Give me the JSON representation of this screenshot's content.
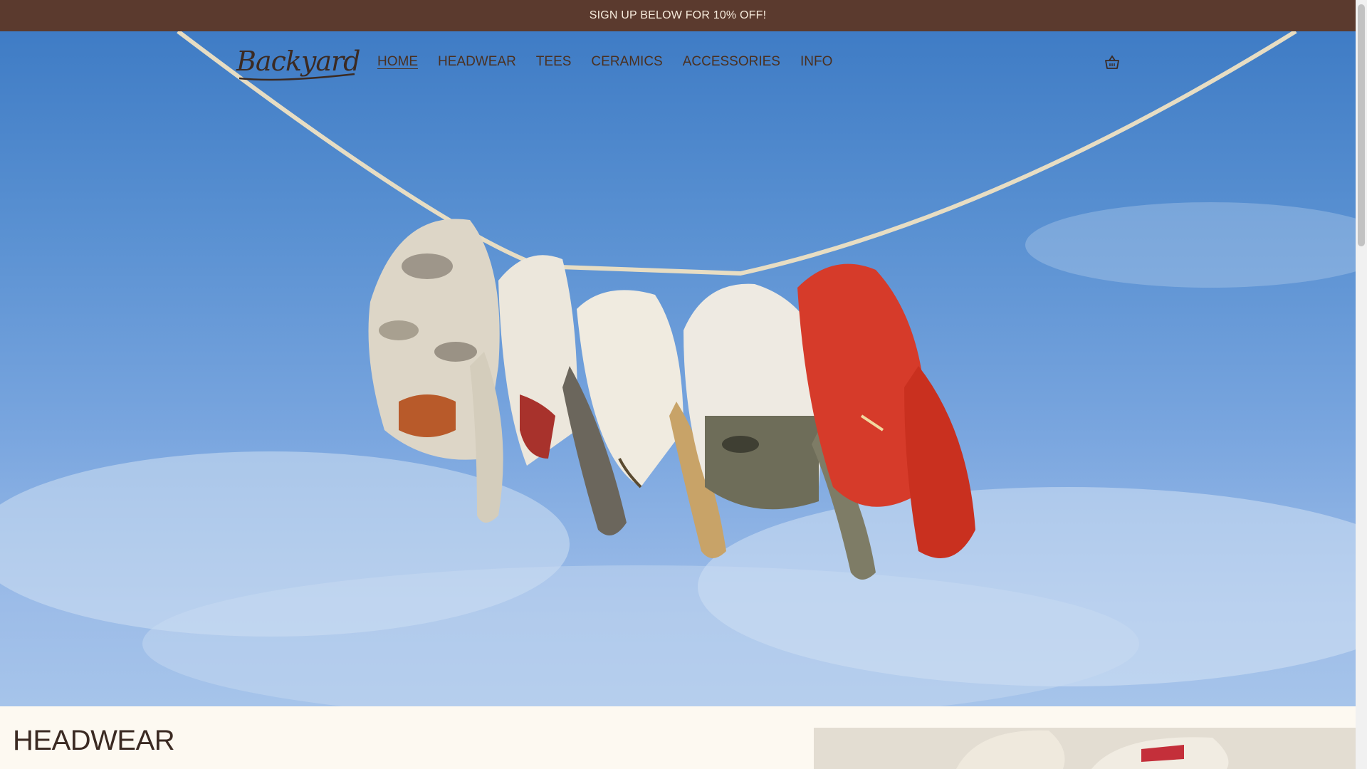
{
  "announcement": "SIGN UP BELOW FOR 10% OFF!",
  "brand": {
    "logo_text": "Backyard"
  },
  "nav": {
    "items": [
      {
        "label": "HOME",
        "active": true
      },
      {
        "label": "HEADWEAR",
        "active": false
      },
      {
        "label": "TEES",
        "active": false
      },
      {
        "label": "CERAMICS",
        "active": false
      },
      {
        "label": "ACCESSORIES",
        "active": false
      },
      {
        "label": "INFO",
        "active": false
      }
    ],
    "cart_icon": "basket-icon"
  },
  "hero": {
    "image": "hats-on-clothesline"
  },
  "sections": {
    "headwear_title": "HEADWEAR"
  },
  "colors": {
    "announcement_bg": "#5b3a2e",
    "announcement_text": "#f6ebdc",
    "nav_text": "#4a3020",
    "page_bg": "#fdf9f1"
  }
}
